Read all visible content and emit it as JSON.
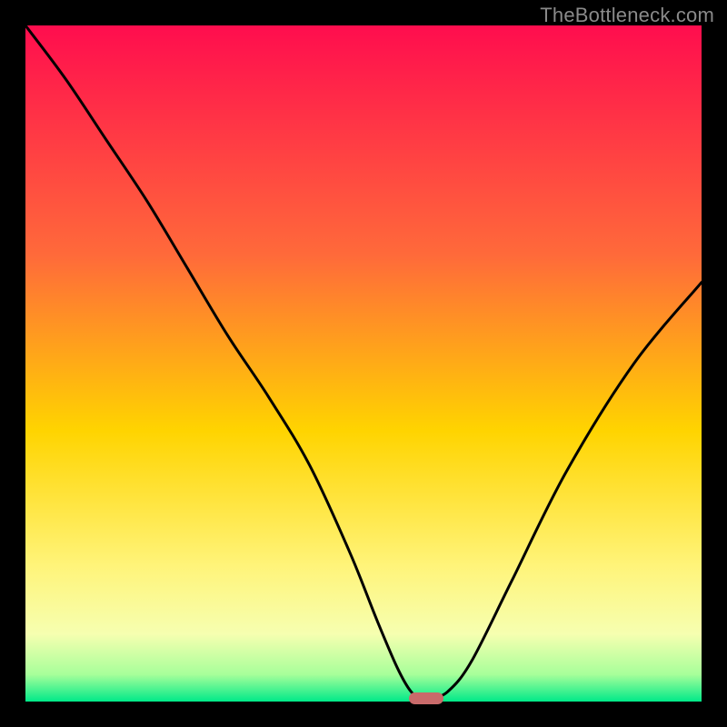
{
  "watermark": "TheBottleneck.com",
  "colors": {
    "black": "#000000",
    "curve": "#000000",
    "marker": "#c96a6a",
    "watermark": "#8a8a8a",
    "grad_top": "#ff0d4e",
    "grad_mid1": "#ff6a3a",
    "grad_mid2": "#ffd400",
    "grad_mid3": "#fff47a",
    "grad_mid4": "#f6ffb0",
    "grad_lgn": "#a7ff9a",
    "grad_bot": "#00e989"
  },
  "chart_data": {
    "type": "line",
    "title": "",
    "xlabel": "",
    "ylabel": "",
    "xlim": [
      0,
      100
    ],
    "ylim": [
      0,
      100
    ],
    "series": [
      {
        "name": "bottleneck-curve",
        "x": [
          0,
          6,
          12,
          18,
          24,
          30,
          36,
          42,
          48,
          52,
          55,
          57,
          58.5,
          60,
          62.5,
          66,
          72,
          80,
          90,
          100
        ],
        "y": [
          100,
          92,
          83,
          74,
          64,
          54,
          45,
          35,
          22,
          12,
          5,
          1.5,
          0.5,
          0.5,
          1.5,
          6,
          18,
          34,
          50,
          62
        ]
      }
    ],
    "marker": {
      "x": 59.3,
      "y": 0.5
    },
    "notes": "Values are estimated from pixel positions; no axis ticks or numeric labels are shown in the image."
  }
}
